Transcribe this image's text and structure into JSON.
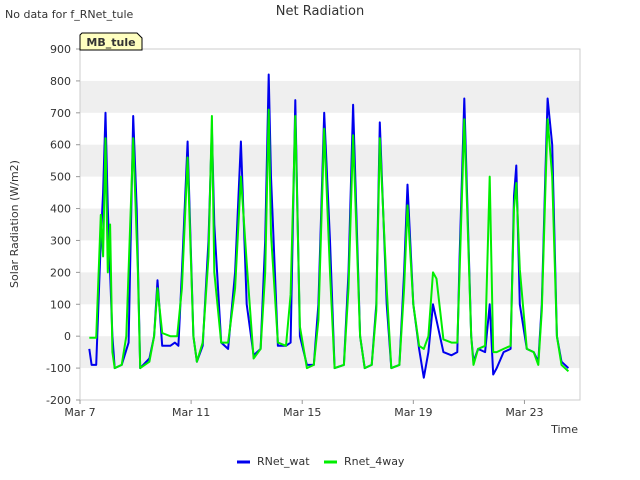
{
  "header": {
    "no_data_note": "No data for f_RNet_tule",
    "site_badge": "MB_tule"
  },
  "colors": {
    "rnet_wat": "#0000ee",
    "rnet_4way": "#00ee00",
    "band": "#efefef",
    "badge_fill": "#ffffc0",
    "badge_text": "#8b0000"
  },
  "chart_data": {
    "type": "line",
    "title": "Net Radiation",
    "xlabel": "Time",
    "ylabel": "Solar Radiation (W/m2)",
    "xlim": [
      "2000-03-07",
      "2000-03-25"
    ],
    "ylim": [
      -200,
      900
    ],
    "x_ticks": [
      {
        "date": "2000-03-07",
        "label": "Mar 7"
      },
      {
        "date": "2000-03-11",
        "label": "Mar 11"
      },
      {
        "date": "2000-03-15",
        "label": "Mar 15"
      },
      {
        "date": "2000-03-19",
        "label": "Mar 19"
      },
      {
        "date": "2000-03-23",
        "label": "Mar 23"
      }
    ],
    "y_ticks": [
      -200,
      -100,
      0,
      100,
      200,
      300,
      400,
      500,
      600,
      700,
      800,
      900
    ],
    "grid": "alternating horizontal bands",
    "legend_position": "bottom-center",
    "series": [
      {
        "name": "RNet_wat",
        "points": [
          [
            "2000-03-07T08:00",
            -40
          ],
          [
            "2000-03-07T10:00",
            -90
          ],
          [
            "2000-03-07T14:00",
            -90
          ],
          [
            "2000-03-07T18:00",
            300
          ],
          [
            "2000-03-07T20:00",
            450
          ],
          [
            "2000-03-07T22:00",
            700
          ],
          [
            "2000-03-08T00:00",
            400
          ],
          [
            "2000-03-08T02:00",
            200
          ],
          [
            "2000-03-08T04:00",
            0
          ],
          [
            "2000-03-08T06:00",
            -100
          ],
          [
            "2000-03-08T12:00",
            -90
          ],
          [
            "2000-03-08T18:00",
            -20
          ],
          [
            "2000-03-08T22:00",
            690
          ],
          [
            "2000-03-09T01:00",
            400
          ],
          [
            "2000-03-09T04:00",
            -100
          ],
          [
            "2000-03-09T12:00",
            -70
          ],
          [
            "2000-03-09T16:00",
            0
          ],
          [
            "2000-03-09T19:00",
            175
          ],
          [
            "2000-03-09T23:00",
            -30
          ],
          [
            "2000-03-10T06:00",
            -30
          ],
          [
            "2000-03-10T10:00",
            -20
          ],
          [
            "2000-03-10T13:00",
            -30
          ],
          [
            "2000-03-10T16:00",
            200
          ],
          [
            "2000-03-10T21:00",
            610
          ],
          [
            "2000-03-11T02:00",
            0
          ],
          [
            "2000-03-11T05:00",
            -80
          ],
          [
            "2000-03-11T10:00",
            -30
          ],
          [
            "2000-03-11T15:00",
            300
          ],
          [
            "2000-03-11T18:00",
            650
          ],
          [
            "2000-03-11T20:00",
            350
          ],
          [
            "2000-03-12T02:00",
            -20
          ],
          [
            "2000-03-12T08:00",
            -40
          ],
          [
            "2000-03-12T14:00",
            200
          ],
          [
            "2000-03-12T19:00",
            610
          ],
          [
            "2000-03-13T00:00",
            100
          ],
          [
            "2000-03-13T06:00",
            -60
          ],
          [
            "2000-03-13T12:00",
            -40
          ],
          [
            "2000-03-13T16:00",
            300
          ],
          [
            "2000-03-13T19:00",
            820
          ],
          [
            "2000-03-13T21:00",
            500
          ],
          [
            "2000-03-14T03:00",
            -30
          ],
          [
            "2000-03-14T10:00",
            -30
          ],
          [
            "2000-03-14T14:00",
            -20
          ],
          [
            "2000-03-14T18:00",
            740
          ],
          [
            "2000-03-14T22:00",
            0
          ],
          [
            "2000-03-15T04:00",
            -90
          ],
          [
            "2000-03-15T10:00",
            -90
          ],
          [
            "2000-03-15T14:00",
            100
          ],
          [
            "2000-03-15T19:00",
            700
          ],
          [
            "2000-03-16T00:00",
            300
          ],
          [
            "2000-03-16T04:00",
            -100
          ],
          [
            "2000-03-16T12:00",
            -90
          ],
          [
            "2000-03-16T16:00",
            200
          ],
          [
            "2000-03-16T20:00",
            725
          ],
          [
            "2000-03-17T02:00",
            0
          ],
          [
            "2000-03-17T06:00",
            -100
          ],
          [
            "2000-03-17T12:00",
            -90
          ],
          [
            "2000-03-17T16:00",
            100
          ],
          [
            "2000-03-17T19:00",
            670
          ],
          [
            "2000-03-18T01:00",
            100
          ],
          [
            "2000-03-18T05:00",
            -100
          ],
          [
            "2000-03-18T12:00",
            -90
          ],
          [
            "2000-03-18T16:00",
            200
          ],
          [
            "2000-03-18T19:00",
            475
          ],
          [
            "2000-03-19T00:00",
            100
          ],
          [
            "2000-03-19T05:00",
            -40
          ],
          [
            "2000-03-19T09:00",
            -130
          ],
          [
            "2000-03-19T13:00",
            -50
          ],
          [
            "2000-03-19T17:00",
            100
          ],
          [
            "2000-03-19T20:00",
            50
          ],
          [
            "2000-03-20T02:00",
            -50
          ],
          [
            "2000-03-20T09:00",
            -60
          ],
          [
            "2000-03-20T14:00",
            -50
          ],
          [
            "2000-03-20T16:00",
            250
          ],
          [
            "2000-03-20T20:00",
            745
          ],
          [
            "2000-03-21T02:00",
            0
          ],
          [
            "2000-03-21T04:00",
            -80
          ],
          [
            "2000-03-21T08:00",
            -40
          ],
          [
            "2000-03-21T14:00",
            -50
          ],
          [
            "2000-03-21T18:00",
            100
          ],
          [
            "2000-03-21T21:00",
            -120
          ],
          [
            "2000-03-22T00:00",
            -100
          ],
          [
            "2000-03-22T06:00",
            -50
          ],
          [
            "2000-03-22T12:00",
            -40
          ],
          [
            "2000-03-22T15:00",
            440
          ],
          [
            "2000-03-22T17:00",
            535
          ],
          [
            "2000-03-22T20:00",
            100
          ],
          [
            "2000-03-23T02:00",
            -40
          ],
          [
            "2000-03-23T08:00",
            -50
          ],
          [
            "2000-03-23T12:00",
            -80
          ],
          [
            "2000-03-23T15:00",
            100
          ],
          [
            "2000-03-23T18:00",
            500
          ],
          [
            "2000-03-23T20:00",
            745
          ],
          [
            "2000-03-24T00:00",
            600
          ],
          [
            "2000-03-24T04:00",
            0
          ],
          [
            "2000-03-24T08:00",
            -80
          ],
          [
            "2000-03-24T14:00",
            -100
          ]
        ]
      },
      {
        "name": "Rnet_4way",
        "points": [
          [
            "2000-03-07T08:00",
            -5
          ],
          [
            "2000-03-07T14:00",
            -5
          ],
          [
            "2000-03-07T18:00",
            380
          ],
          [
            "2000-03-07T20:00",
            250
          ],
          [
            "2000-03-07T22:00",
            620
          ],
          [
            "2000-03-08T00:00",
            200
          ],
          [
            "2000-03-08T02:00",
            350
          ],
          [
            "2000-03-08T04:00",
            -50
          ],
          [
            "2000-03-08T06:00",
            -100
          ],
          [
            "2000-03-08T12:00",
            -90
          ],
          [
            "2000-03-08T16:00",
            0
          ],
          [
            "2000-03-08T22:00",
            620
          ],
          [
            "2000-03-09T02:00",
            200
          ],
          [
            "2000-03-09T04:00",
            -100
          ],
          [
            "2000-03-09T12:00",
            -80
          ],
          [
            "2000-03-09T16:00",
            0
          ],
          [
            "2000-03-09T19:00",
            150
          ],
          [
            "2000-03-09T23:00",
            10
          ],
          [
            "2000-03-10T06:00",
            0
          ],
          [
            "2000-03-10T12:00",
            0
          ],
          [
            "2000-03-10T16:00",
            150
          ],
          [
            "2000-03-10T21:00",
            560
          ],
          [
            "2000-03-11T02:00",
            0
          ],
          [
            "2000-03-11T05:00",
            -80
          ],
          [
            "2000-03-11T10:00",
            -20
          ],
          [
            "2000-03-11T15:00",
            250
          ],
          [
            "2000-03-11T18:00",
            690
          ],
          [
            "2000-03-11T20:00",
            200
          ],
          [
            "2000-03-12T02:00",
            -20
          ],
          [
            "2000-03-12T08:00",
            -20
          ],
          [
            "2000-03-12T14:00",
            150
          ],
          [
            "2000-03-12T19:00",
            500
          ],
          [
            "2000-03-13T00:00",
            230
          ],
          [
            "2000-03-13T06:00",
            -70
          ],
          [
            "2000-03-13T12:00",
            -40
          ],
          [
            "2000-03-13T16:00",
            200
          ],
          [
            "2000-03-13T19:00",
            710
          ],
          [
            "2000-03-13T21:00",
            320
          ],
          [
            "2000-03-14T03:00",
            -20
          ],
          [
            "2000-03-14T10:00",
            -30
          ],
          [
            "2000-03-14T14:00",
            130
          ],
          [
            "2000-03-14T18:00",
            690
          ],
          [
            "2000-03-14T22:00",
            30
          ],
          [
            "2000-03-15T04:00",
            -100
          ],
          [
            "2000-03-15T10:00",
            -90
          ],
          [
            "2000-03-15T14:00",
            50
          ],
          [
            "2000-03-15T19:00",
            650
          ],
          [
            "2000-03-16T00:00",
            200
          ],
          [
            "2000-03-16T04:00",
            -100
          ],
          [
            "2000-03-16T12:00",
            -90
          ],
          [
            "2000-03-16T16:00",
            150
          ],
          [
            "2000-03-16T20:00",
            630
          ],
          [
            "2000-03-17T02:00",
            0
          ],
          [
            "2000-03-17T06:00",
            -100
          ],
          [
            "2000-03-17T12:00",
            -90
          ],
          [
            "2000-03-17T16:00",
            80
          ],
          [
            "2000-03-17T19:00",
            620
          ],
          [
            "2000-03-18T01:00",
            150
          ],
          [
            "2000-03-18T05:00",
            -100
          ],
          [
            "2000-03-18T12:00",
            -90
          ],
          [
            "2000-03-18T16:00",
            150
          ],
          [
            "2000-03-18T19:00",
            410
          ],
          [
            "2000-03-19T00:00",
            100
          ],
          [
            "2000-03-19T05:00",
            -30
          ],
          [
            "2000-03-19T09:00",
            -40
          ],
          [
            "2000-03-19T13:00",
            0
          ],
          [
            "2000-03-19T17:00",
            200
          ],
          [
            "2000-03-19T20:00",
            180
          ],
          [
            "2000-03-20T02:00",
            -10
          ],
          [
            "2000-03-20T09:00",
            -20
          ],
          [
            "2000-03-20T14:00",
            -20
          ],
          [
            "2000-03-20T16:00",
            200
          ],
          [
            "2000-03-20T20:00",
            680
          ],
          [
            "2000-03-21T02:00",
            0
          ],
          [
            "2000-03-21T04:00",
            -90
          ],
          [
            "2000-03-21T08:00",
            -40
          ],
          [
            "2000-03-21T14:00",
            -30
          ],
          [
            "2000-03-21T18:00",
            500
          ],
          [
            "2000-03-21T21:00",
            -50
          ],
          [
            "2000-03-22T00:00",
            -50
          ],
          [
            "2000-03-22T06:00",
            -40
          ],
          [
            "2000-03-22T12:00",
            -30
          ],
          [
            "2000-03-22T15:00",
            400
          ],
          [
            "2000-03-22T17:00",
            480
          ],
          [
            "2000-03-22T20:00",
            210
          ],
          [
            "2000-03-23T02:00",
            -40
          ],
          [
            "2000-03-23T08:00",
            -50
          ],
          [
            "2000-03-23T12:00",
            -90
          ],
          [
            "2000-03-23T15:00",
            80
          ],
          [
            "2000-03-23T18:00",
            450
          ],
          [
            "2000-03-23T20:00",
            680
          ],
          [
            "2000-03-24T00:00",
            500
          ],
          [
            "2000-03-24T04:00",
            0
          ],
          [
            "2000-03-24T08:00",
            -90
          ],
          [
            "2000-03-24T14:00",
            -110
          ]
        ]
      }
    ]
  }
}
